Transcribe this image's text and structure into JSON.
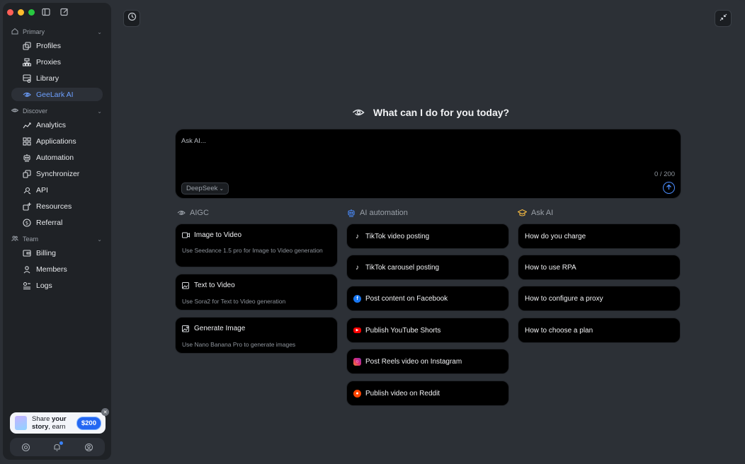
{
  "sidebar": {
    "primary_label": "Primary",
    "discover_label": "Discover",
    "team_label": "Team",
    "primary_items": [
      {
        "label": "Profiles",
        "icon": "profiles-icon"
      },
      {
        "label": "Proxies",
        "icon": "proxies-icon"
      },
      {
        "label": "Library",
        "icon": "library-icon"
      },
      {
        "label": "GeeLark AI",
        "icon": "eye-icon",
        "active": true
      }
    ],
    "discover_items": [
      {
        "label": "Analytics",
        "icon": "analytics-icon"
      },
      {
        "label": "Applications",
        "icon": "applications-icon"
      },
      {
        "label": "Automation",
        "icon": "robot-icon"
      },
      {
        "label": "Synchronizer",
        "icon": "synchronizer-icon"
      },
      {
        "label": "API",
        "icon": "api-icon"
      },
      {
        "label": "Resources",
        "icon": "resources-icon"
      },
      {
        "label": "Referral",
        "icon": "dollar-icon"
      }
    ],
    "team_items": [
      {
        "label": "Billing",
        "icon": "billing-icon"
      },
      {
        "label": "Members",
        "icon": "members-icon"
      },
      {
        "label": "Logs",
        "icon": "logs-icon"
      }
    ],
    "promo": {
      "line1_a": "Share ",
      "line1_b": "your",
      "line2_a": "story",
      "line2_b": ", earn",
      "badge": "$200"
    }
  },
  "main": {
    "heading": "What can I do for you today?",
    "ask_placeholder": "Ask AI...",
    "model": "DeepSeek",
    "counter": "0 / 200",
    "columns": [
      {
        "title": "AIGC"
      },
      {
        "title": "AI automation"
      },
      {
        "title": "Ask AI"
      }
    ],
    "aigc_cards": [
      {
        "title": "Image to Video",
        "desc": "Use Seedance 1.5 pro for Image to Video generation"
      },
      {
        "title": "Text to Video",
        "desc": "Use Sora2 for Text to Video generation"
      },
      {
        "title": "Generate Image",
        "desc": "Use Nano Banana Pro to generate images"
      }
    ],
    "automation_items": [
      "TikTok video posting",
      "TikTok carousel posting",
      "Post content on Facebook",
      "Publish YouTube Shorts",
      "Post Reels video on Instagram",
      "Publish video on Reddit"
    ],
    "ask_items": [
      "How do you charge",
      "How to use RPA",
      "How to configure a proxy",
      "How to choose a plan"
    ]
  },
  "colors": {
    "accent": "#6da0ff",
    "facebook": "#1877f2",
    "youtube": "#ff0000",
    "instagram": "#e1306c",
    "reddit": "#ff4500"
  }
}
